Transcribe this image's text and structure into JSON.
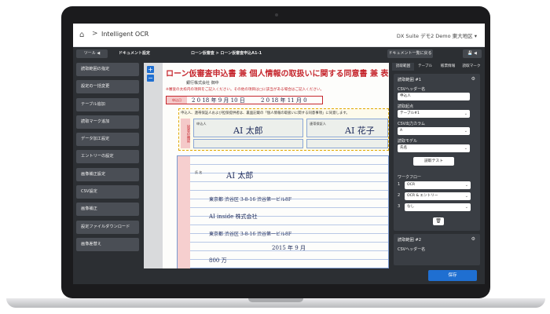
{
  "topbar": {
    "breadcrumb_sep": ">",
    "app_title": "Intelligent OCR",
    "tenant": "DX Suite デモ2 Demo 東大地区 ▾"
  },
  "toolbar": {
    "tools_label": "ツール ◀",
    "doc_settings": "ドキュメント設定",
    "doc_path": "ローン仮審査 > ローン仮審査申込A1-1",
    "back_to_list": "ドキュメント一覧に戻る",
    "save_icon_label": "💾 ◀"
  },
  "sidebar": {
    "items": [
      {
        "label": "読取範囲の指定"
      },
      {
        "label": "設定の一括変更"
      },
      {
        "label": "テーブル追加"
      },
      {
        "label": "読取マーク追加"
      },
      {
        "label": "データ加工設定"
      },
      {
        "label": "エントリーの設定"
      },
      {
        "label": "画像補正設定"
      },
      {
        "label": "CSV設定"
      },
      {
        "label": "画像補正"
      },
      {
        "label": "設定ファイルダウンロード"
      },
      {
        "label": "画像差替え"
      }
    ]
  },
  "document": {
    "zoom_in": "+",
    "zoom_out": "−",
    "title": "ローン仮審査申込書 兼 個人情報の取扱いに関する同意書 兼 表明",
    "bank": "銀行株式会社 御中",
    "red_note": "※審査の太枠内の項目をご記入ください。その他の項目は□に該当がある場合はご記入ください。",
    "date_label": "申込日",
    "date_value": "2 0 18 年 9 月 10 日",
    "date_value2": "2 0 18 年 11 月 0",
    "yellow_head": "申込人、連帯保証人および担保提供者は、裏面記載の「個人情報の取扱いに関する同意事項」に同意します。",
    "vertical_label": "同意の確認",
    "applicant_label": "申込人",
    "applicant_name": "AI 太郎",
    "guarantor_label": "連帯保証人",
    "guarantor_name": "AI 花子",
    "grid_name_label": "氏 名",
    "grid_name": "AI 太郎",
    "grid_address": "東京都 渋谷区 3-8-16 渋谷第一ビル8F",
    "grid_company": "AI inside 株式会社",
    "grid_company_address": "東京都 渋谷区 3-8-16 渋谷第一ビル8F",
    "grid_amount": "800 万",
    "grid_year": "2015 年 9 月"
  },
  "rightpanel": {
    "tabs": [
      "読取範囲",
      "テーブル",
      "帳票情報",
      "読取マーク"
    ],
    "card1_title": "読取範囲 #1",
    "csv_header_label": "CSVヘッダー名",
    "csv_header_value": "申込人",
    "read_start_label": "読取起点",
    "read_start_value": "テーブル#1",
    "csv_column_label": "CSV出力カラム",
    "csv_column_value": "A",
    "read_model_label": "読取モデル",
    "read_model_value": "氏名",
    "test_button": "読取テスト",
    "workflow_label": "ワークフロー",
    "workflow_steps": [
      {
        "num": "1",
        "value": "OCR"
      },
      {
        "num": "2",
        "value": "OCR & エントリー"
      },
      {
        "num": "3",
        "value": "なし"
      }
    ],
    "card2_title": "読取範囲 #2",
    "card2_csv_label": "CSVヘッダー名"
  },
  "footer": {
    "save_label": "保存"
  }
}
